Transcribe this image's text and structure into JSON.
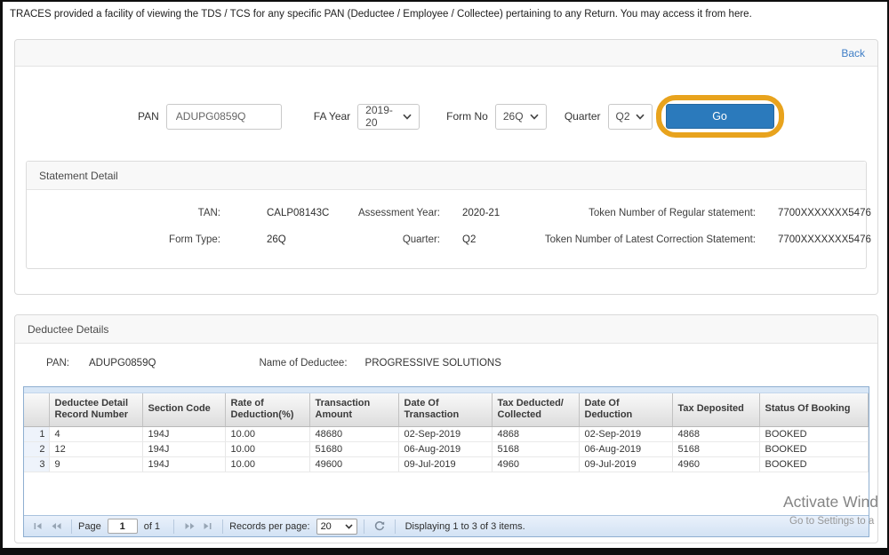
{
  "intro": "TRACES provided a facility of viewing the TDS / TCS for any specific PAN (Deductee / Employee / Collectee) pertaining to any Return. You may access it from here.",
  "toolbar": {
    "back_label": "Back"
  },
  "query_form": {
    "pan_label": "PAN",
    "pan_value": "ADUPG0859Q",
    "fa_year_label": "FA Year",
    "fa_year_value": "2019-20",
    "form_no_label": "Form No",
    "form_no_value": "26Q",
    "quarter_label": "Quarter",
    "quarter_value": "Q2",
    "go_label": "Go"
  },
  "statement_detail": {
    "title": "Statement Detail",
    "fields": [
      {
        "label": "TAN:",
        "value": "CALP08143C"
      },
      {
        "label": "Assessment Year:",
        "value": "2020-21"
      },
      {
        "label": "Token Number of Regular statement:",
        "value": "7700XXXXXXX5476"
      },
      {
        "label": "Form Type:",
        "value": "26Q"
      },
      {
        "label": "Quarter:",
        "value": "Q2"
      },
      {
        "label": "Token Number of Latest Correction Statement:",
        "value": "7700XXXXXXX5476"
      }
    ]
  },
  "deductee_details": {
    "title": "Deductee Details",
    "pan_label": "PAN:",
    "pan_value": "ADUPG0859Q",
    "name_label": "Name of Deductee:",
    "name_value": "PROGRESSIVE SOLUTIONS",
    "table": {
      "columns": [
        "Deductee Detail Record Number",
        "Section Code",
        "Rate of Deduction(%)",
        "Transaction Amount",
        "Date Of Transaction",
        "Tax Deducted/ Collected",
        "Date Of Deduction",
        "Tax Deposited",
        "Status Of Booking"
      ],
      "rows": [
        {
          "num": "1",
          "cells": [
            "4",
            "194J",
            "10.00",
            "48680",
            "02-Sep-2019",
            "4868",
            "02-Sep-2019",
            "4868",
            "BOOKED"
          ]
        },
        {
          "num": "2",
          "cells": [
            "12",
            "194J",
            "10.00",
            "51680",
            "06-Aug-2019",
            "5168",
            "06-Aug-2019",
            "5168",
            "BOOKED"
          ]
        },
        {
          "num": "3",
          "cells": [
            "9",
            "194J",
            "10.00",
            "49600",
            "09-Jul-2019",
            "4960",
            "09-Jul-2019",
            "4960",
            "BOOKED"
          ]
        }
      ]
    },
    "pager": {
      "page_label": "Page",
      "page_value": "1",
      "of_label": "of  1",
      "records_label": "Records per page:",
      "records_value": "20",
      "status": "Displaying 1 to 3 of 3 items."
    }
  },
  "watermark": {
    "line1": "Activate Wind",
    "line2": "Go to Settings to a"
  },
  "colors": {
    "go_button": "#2B7ABC",
    "highlight_ring": "#E8A31D",
    "back_link": "#3F7EC6",
    "pager_bar": "#D3E2F4"
  },
  "icons": {
    "first_page": "|◀",
    "prev_page": "◀◀",
    "next_page": "▶▶",
    "last_page": "▶|",
    "refresh": "⟳",
    "chevron_down": "▾"
  }
}
